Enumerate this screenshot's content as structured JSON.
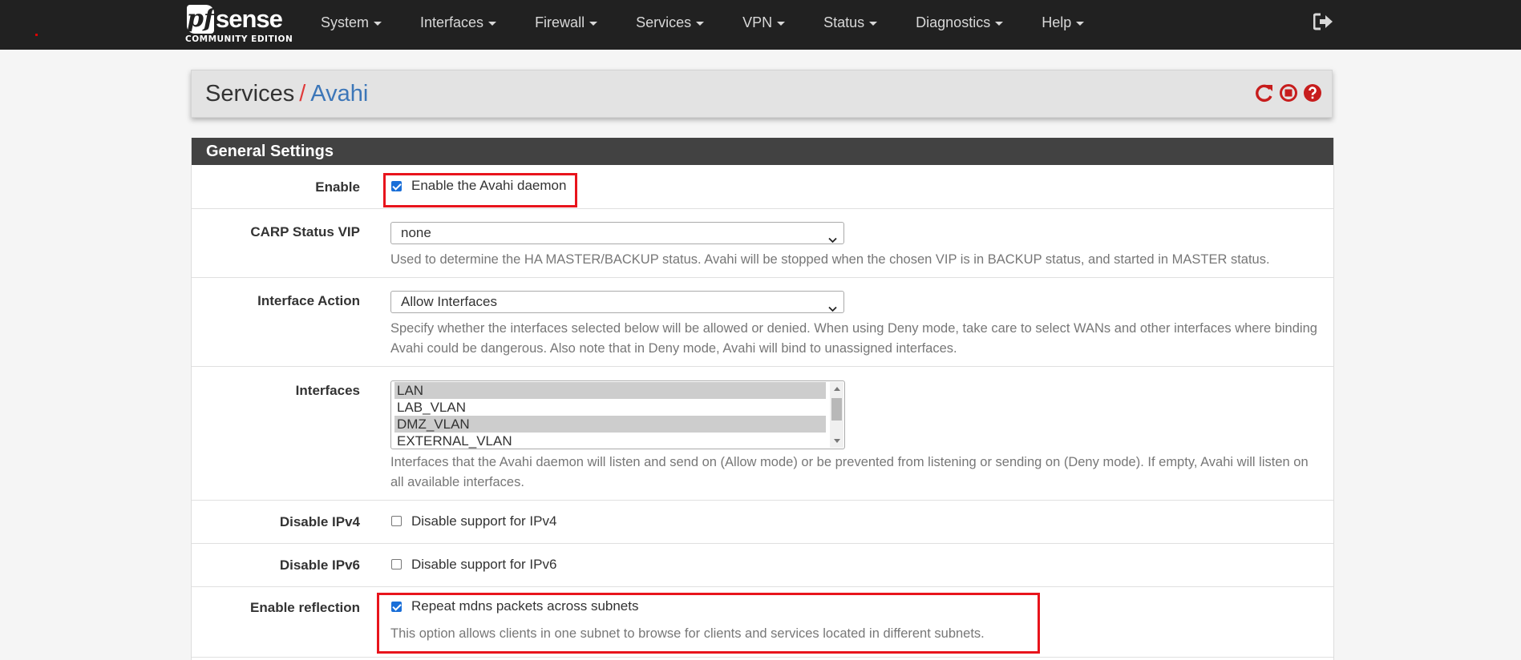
{
  "navbar": {
    "logo_pf": "pf",
    "logo_sense": "sense",
    "logo_edition": "COMMUNITY EDITION",
    "menu": [
      "System",
      "Interfaces",
      "Firewall",
      "Services",
      "VPN",
      "Status",
      "Diagnostics",
      "Help"
    ],
    "logout_icon": "sign-out-icon"
  },
  "breadcrumb": {
    "section": "Services",
    "separator": "/",
    "page": "Avahi",
    "icons": [
      "restart-service-icon",
      "stop-service-icon",
      "help-icon"
    ]
  },
  "panel": {
    "title": "General Settings",
    "enable": {
      "label": "Enable",
      "checkbox_label": "Enable the Avahi daemon",
      "checked": true
    },
    "carp": {
      "label": "CARP Status VIP",
      "value": "none",
      "help": "Used to determine the HA MASTER/BACKUP status. Avahi will be stopped when the chosen VIP is in BACKUP status, and started in MASTER status."
    },
    "interface_action": {
      "label": "Interface Action",
      "value": "Allow Interfaces",
      "help": "Specify whether the interfaces selected below will be allowed or denied. When using Deny mode, take care to select WANs and other interfaces where binding Avahi could be dangerous. Also note that in Deny mode, Avahi will bind to unassigned interfaces."
    },
    "interfaces": {
      "label": "Interfaces",
      "options": [
        {
          "name": "LAN",
          "selected": true
        },
        {
          "name": "LAB_VLAN",
          "selected": false
        },
        {
          "name": "DMZ_VLAN",
          "selected": true
        },
        {
          "name": "EXTERNAL_VLAN",
          "selected": false
        }
      ],
      "help": "Interfaces that the Avahi daemon will listen and send on (Allow mode) or be prevented from listening or sending on (Deny mode). If empty, Avahi will listen on all available interfaces."
    },
    "disable_ipv4": {
      "label": "Disable IPv4",
      "checkbox_label": "Disable support for IPv4",
      "checked": false
    },
    "disable_ipv6": {
      "label": "Disable IPv6",
      "checkbox_label": "Disable support for IPv6",
      "checked": false
    },
    "reflection": {
      "label": "Enable reflection",
      "checkbox_label": "Repeat mdns packets across subnets",
      "checked": true,
      "help": "This option allows clients in one subnet to browse for clients and services located in different subnets."
    }
  },
  "colors": {
    "navbar_bg": "#212121",
    "panel_heading_bg": "#424242",
    "accent_link": "#3c76b8",
    "icon_red": "#c71d1d",
    "highlight_red": "#e8141c",
    "checkbox_blue": "#1a6fd8"
  }
}
